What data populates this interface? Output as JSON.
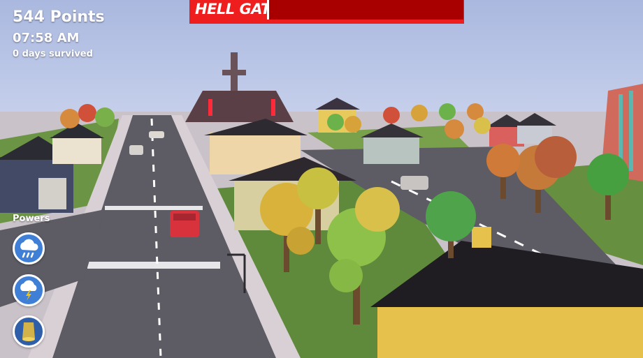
{
  "hud": {
    "points": "544 Points",
    "time": "07:58 AM",
    "days": "0 days survived"
  },
  "boss": {
    "name": "HELL GATE",
    "health_fraction": 1.0
  },
  "powers": {
    "label": "Powers",
    "items": [
      {
        "icon": "rain-cloud-icon"
      },
      {
        "icon": "lightning-cloud-icon"
      },
      {
        "icon": "light-beam-icon"
      }
    ]
  },
  "colors": {
    "sky": "#b9c6e6",
    "boss_bar": "#ee1e1e",
    "boss_fill": "#a80000",
    "power_button": "#3f7fd6"
  }
}
